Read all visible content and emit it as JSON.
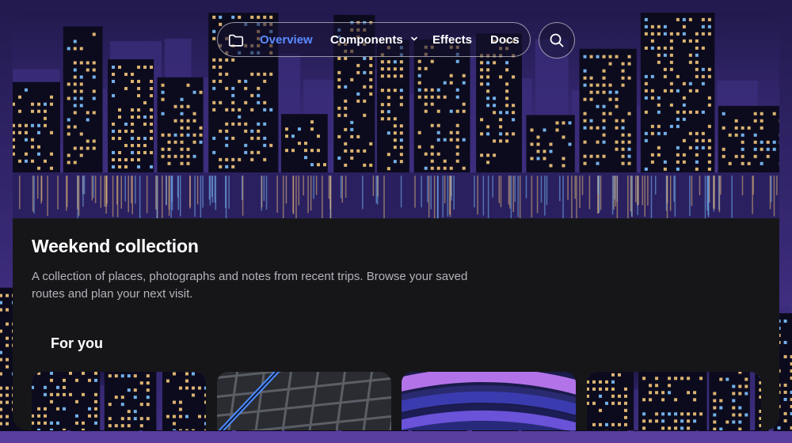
{
  "nav": {
    "items": [
      {
        "label": "Overview",
        "active": true
      },
      {
        "label": "Components",
        "has_dropdown": true
      },
      {
        "label": "Effects"
      },
      {
        "label": "Docs"
      }
    ],
    "left_icon": "folder-icon",
    "search_icon": "search-icon",
    "dropdown_icon": "chevron-down-icon"
  },
  "page": {
    "title": "Weekend collection",
    "description": "A collection of places, photographs and notes from recent trips. Browse your saved routes and plan your next visit."
  },
  "section": {
    "title": "For you"
  },
  "cards": [
    {
      "theme": "city-night"
    },
    {
      "theme": "map-grid"
    },
    {
      "theme": "purple-waves"
    },
    {
      "theme": "city-night"
    }
  ],
  "colors": {
    "accent": "#5b8cff",
    "card_background": "#161619",
    "page_background": "#0a0a16",
    "text_primary": "#ffffff",
    "text_secondary": "#b3b3ba",
    "window_warm": "#f3c67a",
    "window_cool": "#7ec3ff",
    "sky_purple": "#3a2a78"
  }
}
